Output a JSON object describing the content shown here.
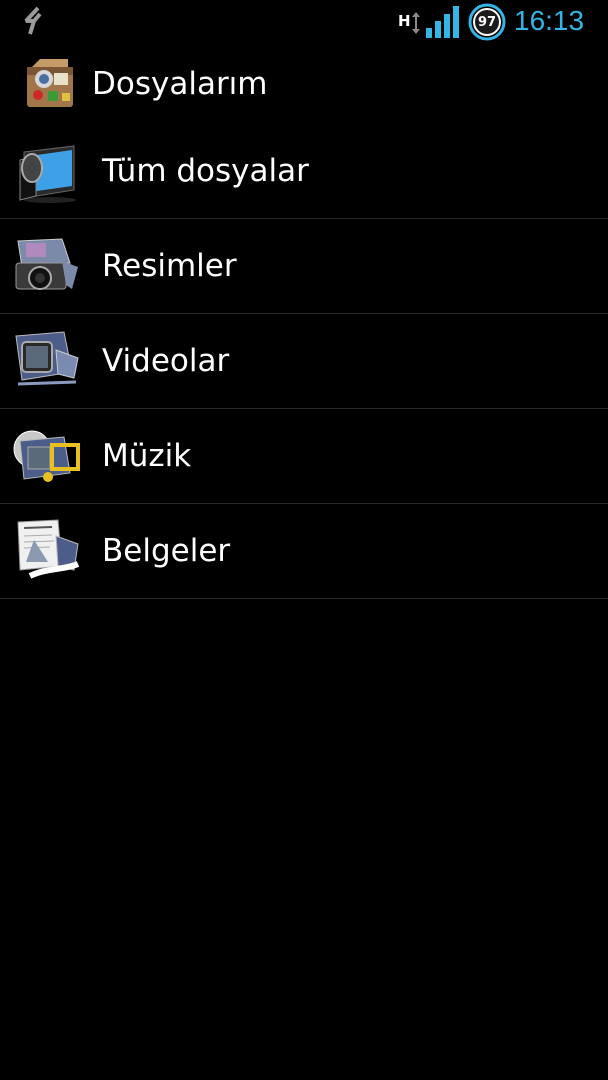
{
  "status_bar": {
    "sync_icon": "sync-icon",
    "network_type": "H",
    "signal_icon": "signal-bars-icon",
    "battery_level": "97",
    "time": "16:13",
    "accent_color": "#33b5e5"
  },
  "action_bar": {
    "app_icon": "my-files-app-icon",
    "title": "Dosyalarım"
  },
  "list": {
    "items": [
      {
        "label": "Tüm dosyalar",
        "icon": "folder-icon"
      },
      {
        "label": "Resimler",
        "icon": "camera-icon"
      },
      {
        "label": "Videolar",
        "icon": "video-icon"
      },
      {
        "label": "Müzik",
        "icon": "music-icon"
      },
      {
        "label": "Belgeler",
        "icon": "document-icon"
      }
    ]
  },
  "colors": {
    "background": "#000000",
    "text": "#ffffff",
    "divider": "#2a2a2a"
  }
}
